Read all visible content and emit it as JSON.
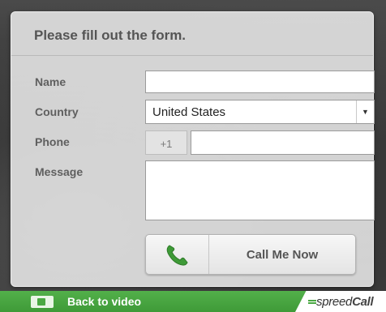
{
  "form": {
    "title": "Please fill out the form.",
    "name_label": "Name",
    "country_label": "Country",
    "country_value": "United States",
    "phone_label": "Phone",
    "phone_prefix": "+1",
    "message_label": "Message",
    "call_button_label": "Call Me Now"
  },
  "footer": {
    "back_label": "Back to video",
    "brand_light": "spreed",
    "brand_bold": "Call"
  },
  "icons": {
    "phone": "phone-handset-icon",
    "video": "video-camera-icon",
    "dropdown": "chevron-down-icon"
  },
  "colors": {
    "accent_green": "#3f9a38",
    "phone_icon_green": "#3e9a37"
  }
}
